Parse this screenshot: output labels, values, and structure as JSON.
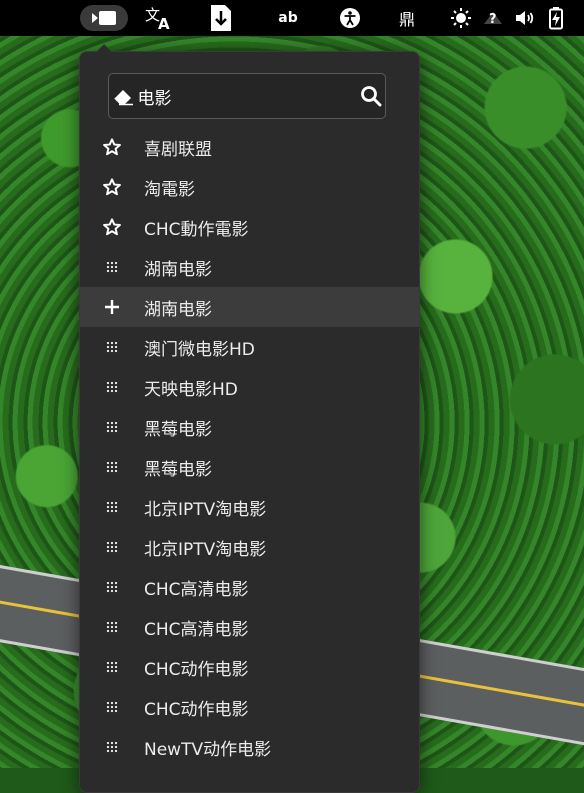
{
  "topbar": {
    "items": [
      {
        "name": "app-indicator",
        "icon": "media-player-icon"
      },
      {
        "name": "translate",
        "icon": "translate-icon"
      },
      {
        "name": "download",
        "icon": "download-icon"
      },
      {
        "name": "spellcheck",
        "label": "ab"
      },
      {
        "name": "accessibility",
        "icon": "accessibility-icon"
      },
      {
        "name": "input-method",
        "label": "鼎"
      },
      {
        "name": "brightness",
        "icon": "brightness-icon"
      },
      {
        "name": "help",
        "icon": "help-icon"
      },
      {
        "name": "volume",
        "icon": "volume-icon"
      },
      {
        "name": "battery",
        "icon": "battery-charging-icon"
      }
    ]
  },
  "search": {
    "value": "电影",
    "placeholder": ""
  },
  "list": {
    "items": [
      {
        "icon": "star",
        "label": "喜剧联盟"
      },
      {
        "icon": "star",
        "label": "淘電影"
      },
      {
        "icon": "star",
        "label": "CHC動作電影"
      },
      {
        "icon": "grip",
        "label": "湖南电影"
      },
      {
        "icon": "plus",
        "label": "湖南电影"
      },
      {
        "icon": "grip",
        "label": "澳门微电影HD"
      },
      {
        "icon": "grip",
        "label": "天映电影HD"
      },
      {
        "icon": "grip",
        "label": "黑莓电影"
      },
      {
        "icon": "grip",
        "label": "黑莓电影"
      },
      {
        "icon": "grip",
        "label": "北京IPTV淘电影"
      },
      {
        "icon": "grip",
        "label": "北京IPTV淘电影"
      },
      {
        "icon": "grip",
        "label": "CHC高清电影"
      },
      {
        "icon": "grip",
        "label": "CHC高清电影"
      },
      {
        "icon": "grip",
        "label": "CHC动作电影"
      },
      {
        "icon": "grip",
        "label": "CHC动作电影"
      },
      {
        "icon": "grip",
        "label": "NewTV动作电影"
      }
    ]
  },
  "colors": {
    "popup_bg": "#2b2b2b",
    "highlight_bg": "#3c3c3c",
    "topbar_bg": "#000000"
  }
}
